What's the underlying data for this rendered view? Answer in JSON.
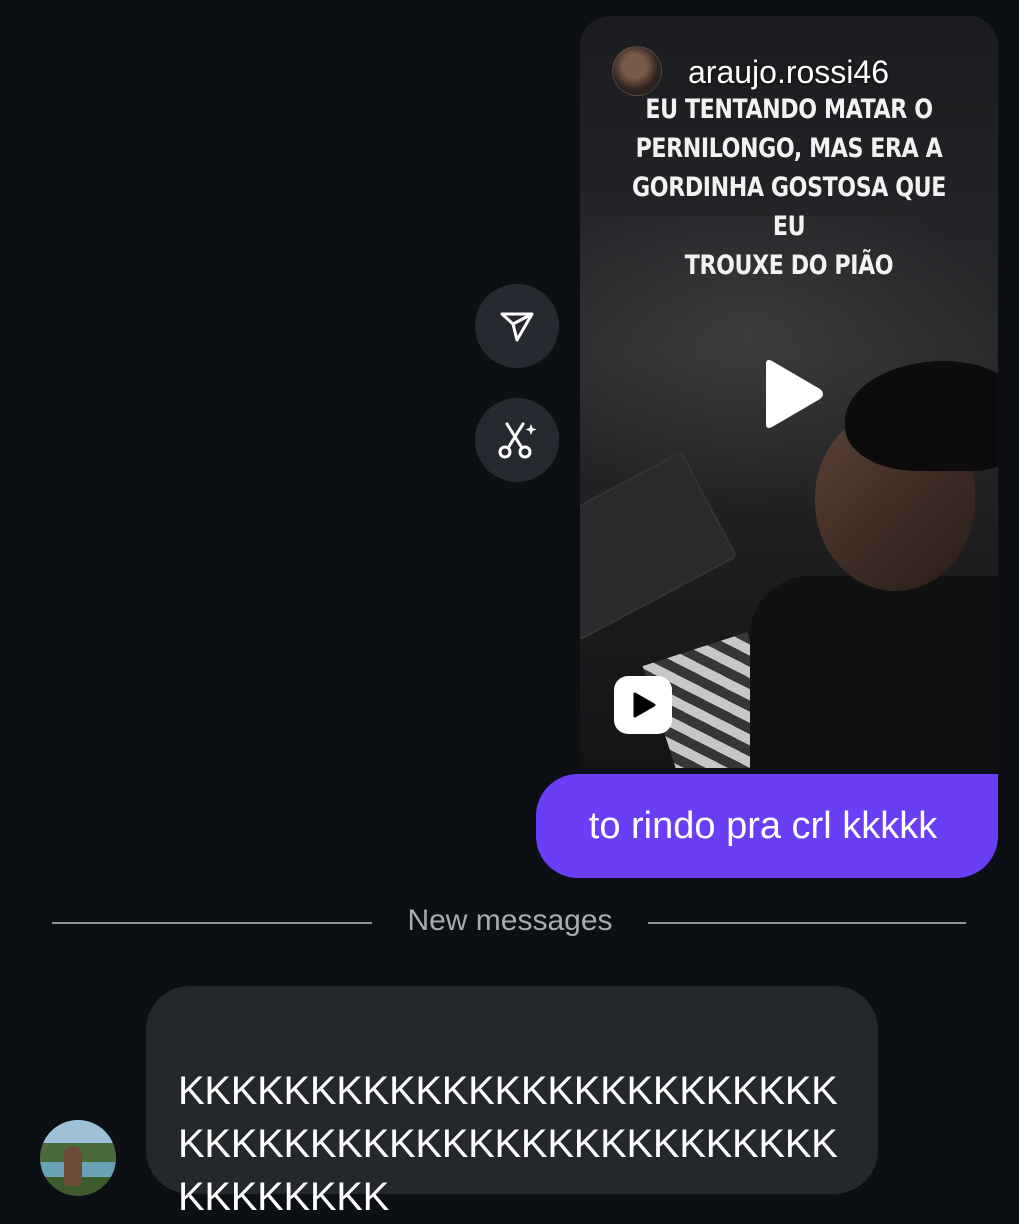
{
  "reel": {
    "owner_username": "araujo.rossi46",
    "caption_lines": [
      "EU TENTANDO MATAR O",
      "PERNILONGO, MAS ERA A",
      "GORDINHA GOSTOSA QUE EU",
      "TROUXE DO PIÃO"
    ],
    "play_icon": "play-icon",
    "badge_icon": "reels-icon"
  },
  "actions": {
    "share_icon": "send-icon",
    "remix_icon": "scissors-sparkle-icon"
  },
  "outgoing_message": {
    "text": "to rindo pra crl kkkkk",
    "bubble_color": "#6a3ef6"
  },
  "divider": {
    "label": "New messages"
  },
  "incoming_message": {
    "text": "KKKKKKKKKKKKKKKKKKKKKKKKKKKKKKKKKKKKKKKKKKKKKKKKKKKKKKKKKK",
    "bubble_color": "#24272c"
  },
  "colors": {
    "background": "#0c0f14",
    "accent": "#6a3ef6",
    "divider_text": "#a7acb2"
  }
}
